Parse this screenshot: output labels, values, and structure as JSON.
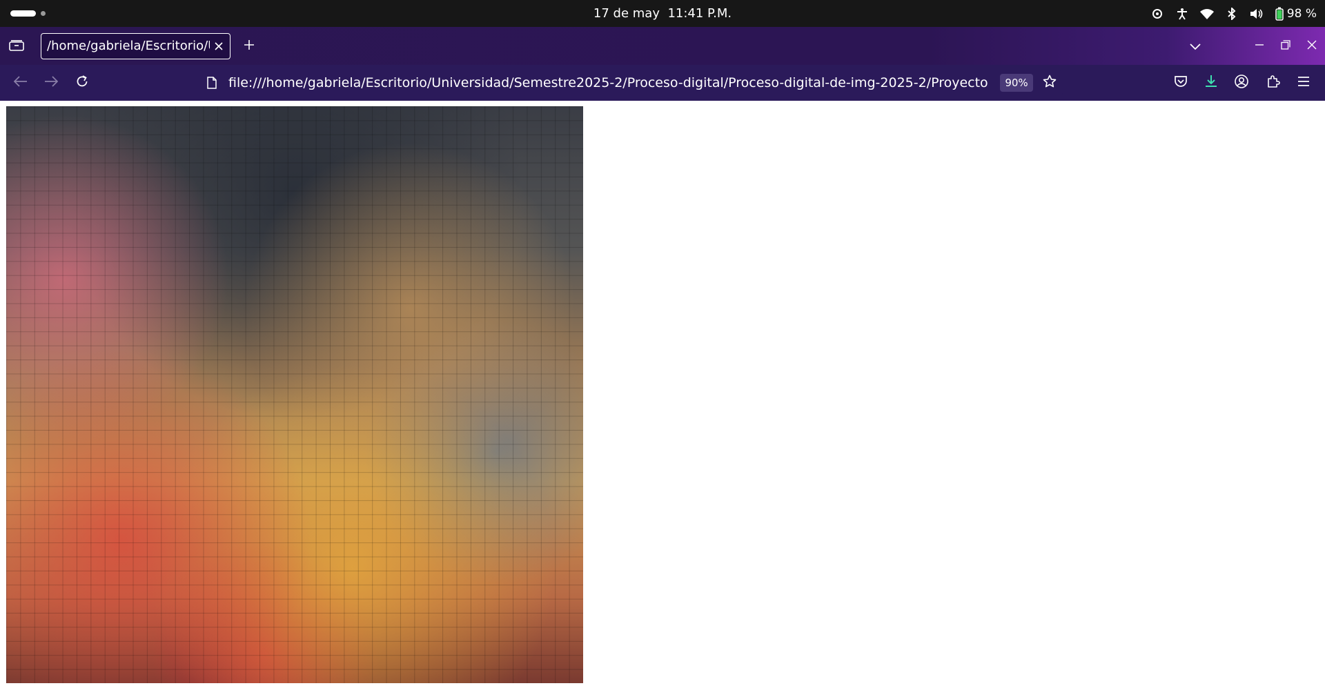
{
  "system_bar": {
    "date": "17 de may",
    "time": "11:41 P.M.",
    "battery": "98 %"
  },
  "browser": {
    "tab": {
      "title": "/home/gabriela/Escritorio/Universidad/Semestre2025-2/Proceso-digital/Proceso-digital-de-img-2025-2/Proyecto-final/Fotomosaico.html"
    },
    "url": "file:///home/gabriela/Escritorio/Universidad/Semestre2025-2/Proceso-digital/Proceso-digital-de-img-2025-2/Proyecto-final/Fotomosaico.html",
    "zoom": "90%"
  },
  "colors": {
    "tab_strip": "#2b1653",
    "nav_bar": "#2b1a5a",
    "top_bar": "#171717"
  },
  "icons": [
    "tab-list-icon",
    "close-icon",
    "plus-icon",
    "chevron-down-icon",
    "minimize-icon",
    "restore-icon",
    "window-close-icon",
    "back-arrow-icon",
    "forward-arrow-icon",
    "reload-icon",
    "page-icon",
    "bookmark-star-icon",
    "pocket-icon",
    "download-icon",
    "account-icon",
    "extensions-icon",
    "menu-icon"
  ]
}
